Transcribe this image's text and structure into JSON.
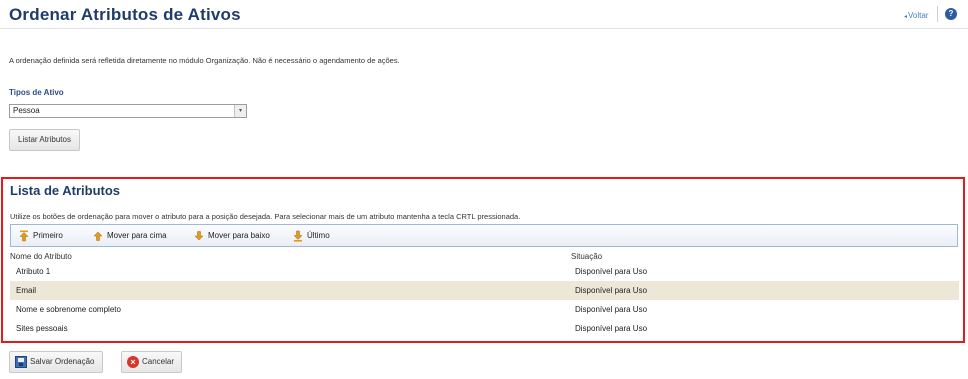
{
  "header": {
    "title": "Ordenar Atributos de Ativos",
    "back_label": "Voltar",
    "back_arrow": "◂",
    "help_label": "?"
  },
  "intro": {
    "text": "A ordenação definida será refletida diretamente no módulo Organização. Não é necessário o agendamento de ações."
  },
  "asset_type": {
    "label": "Tipos de Ativo",
    "selected": "Pessoa",
    "arrow": "▾"
  },
  "list_button": {
    "label": "Listar Atributos"
  },
  "attributes_panel": {
    "title": "Lista de Atributos",
    "hint": "Utilize os botões de ordenação para mover o atributo para a posição desejada. Para selecionar mais de um atributo mantenha a tecla CRTL pressionada.",
    "toolbar": {
      "first": "Primeiro",
      "up": "Mover para cima",
      "down": "Mover para baixo",
      "last": "Último"
    },
    "columns": {
      "name": "Nome do Atributo",
      "status": "Situação"
    },
    "rows": [
      {
        "name": "Atributo 1",
        "status": "Disponível para Uso",
        "selected": false
      },
      {
        "name": "Email",
        "status": "Disponível para Uso",
        "selected": true
      },
      {
        "name": "Nome e sobrenome completo",
        "status": "Disponível para Uso",
        "selected": false
      },
      {
        "name": "Sites pessoais",
        "status": "Disponível para Uso",
        "selected": false
      }
    ]
  },
  "footer": {
    "save_label": "Salvar Ordenação",
    "cancel_label": "Cancelar",
    "cancel_icon": "×"
  },
  "colors": {
    "title": "#1f3d6b",
    "highlight_border": "#e31b1b",
    "selected_row": "#ece7d6",
    "icon_orange": "#e39b1c"
  }
}
